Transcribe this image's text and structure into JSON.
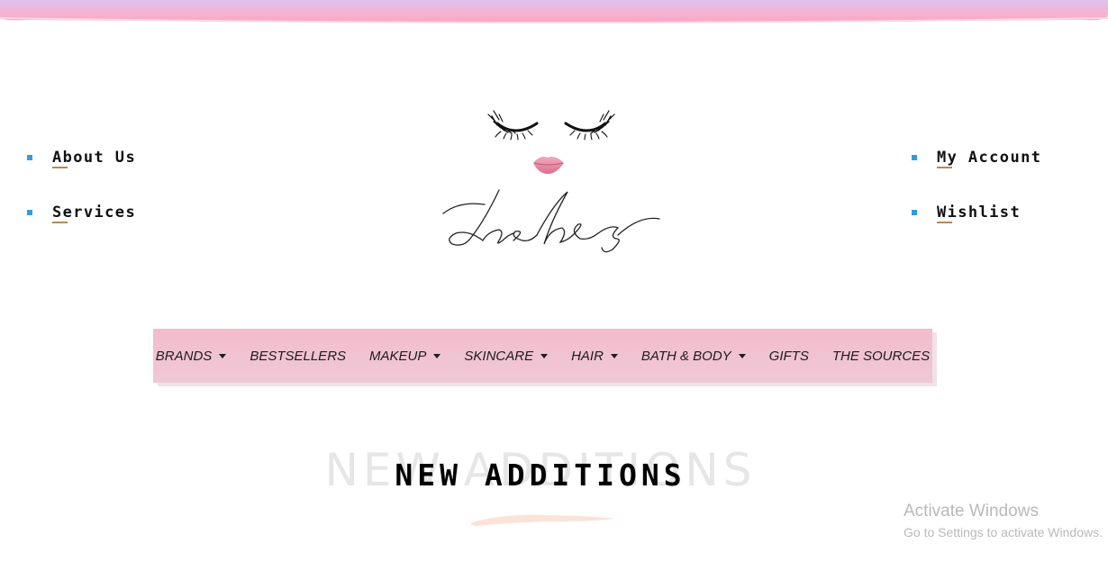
{
  "colors": {
    "top_band_start": "#d9b8f0",
    "top_band_end": "#f8a9c8",
    "nav_bg": "#f3bccd",
    "bullet": "#2c9fe0",
    "underline_accent": "#b08a5a"
  },
  "left_links": [
    {
      "label": "About Us"
    },
    {
      "label": "Services"
    }
  ],
  "right_links": [
    {
      "label": "My Account"
    },
    {
      "label": "Wishlist"
    }
  ],
  "logo": {
    "wordmark": "Lashes",
    "icons": [
      "closed-eye-lashes-icon",
      "lips-icon"
    ]
  },
  "nav": {
    "items": [
      {
        "label": "BRANDS",
        "dropdown": true
      },
      {
        "label": "BESTSELLERS",
        "dropdown": false
      },
      {
        "label": "MAKEUP",
        "dropdown": true
      },
      {
        "label": "SKINCARE",
        "dropdown": true
      },
      {
        "label": "HAIR",
        "dropdown": true
      },
      {
        "label": "BATH & BODY",
        "dropdown": true
      },
      {
        "label": "GIFTS",
        "dropdown": false
      },
      {
        "label": "THE SOURCES",
        "dropdown": false
      }
    ]
  },
  "section": {
    "heading_bg": "NEW ADDITIONS",
    "heading": "NEW ADDITIONS"
  },
  "watermark": {
    "title": "Activate Windows",
    "subtitle": "Go to Settings to activate Windows."
  }
}
